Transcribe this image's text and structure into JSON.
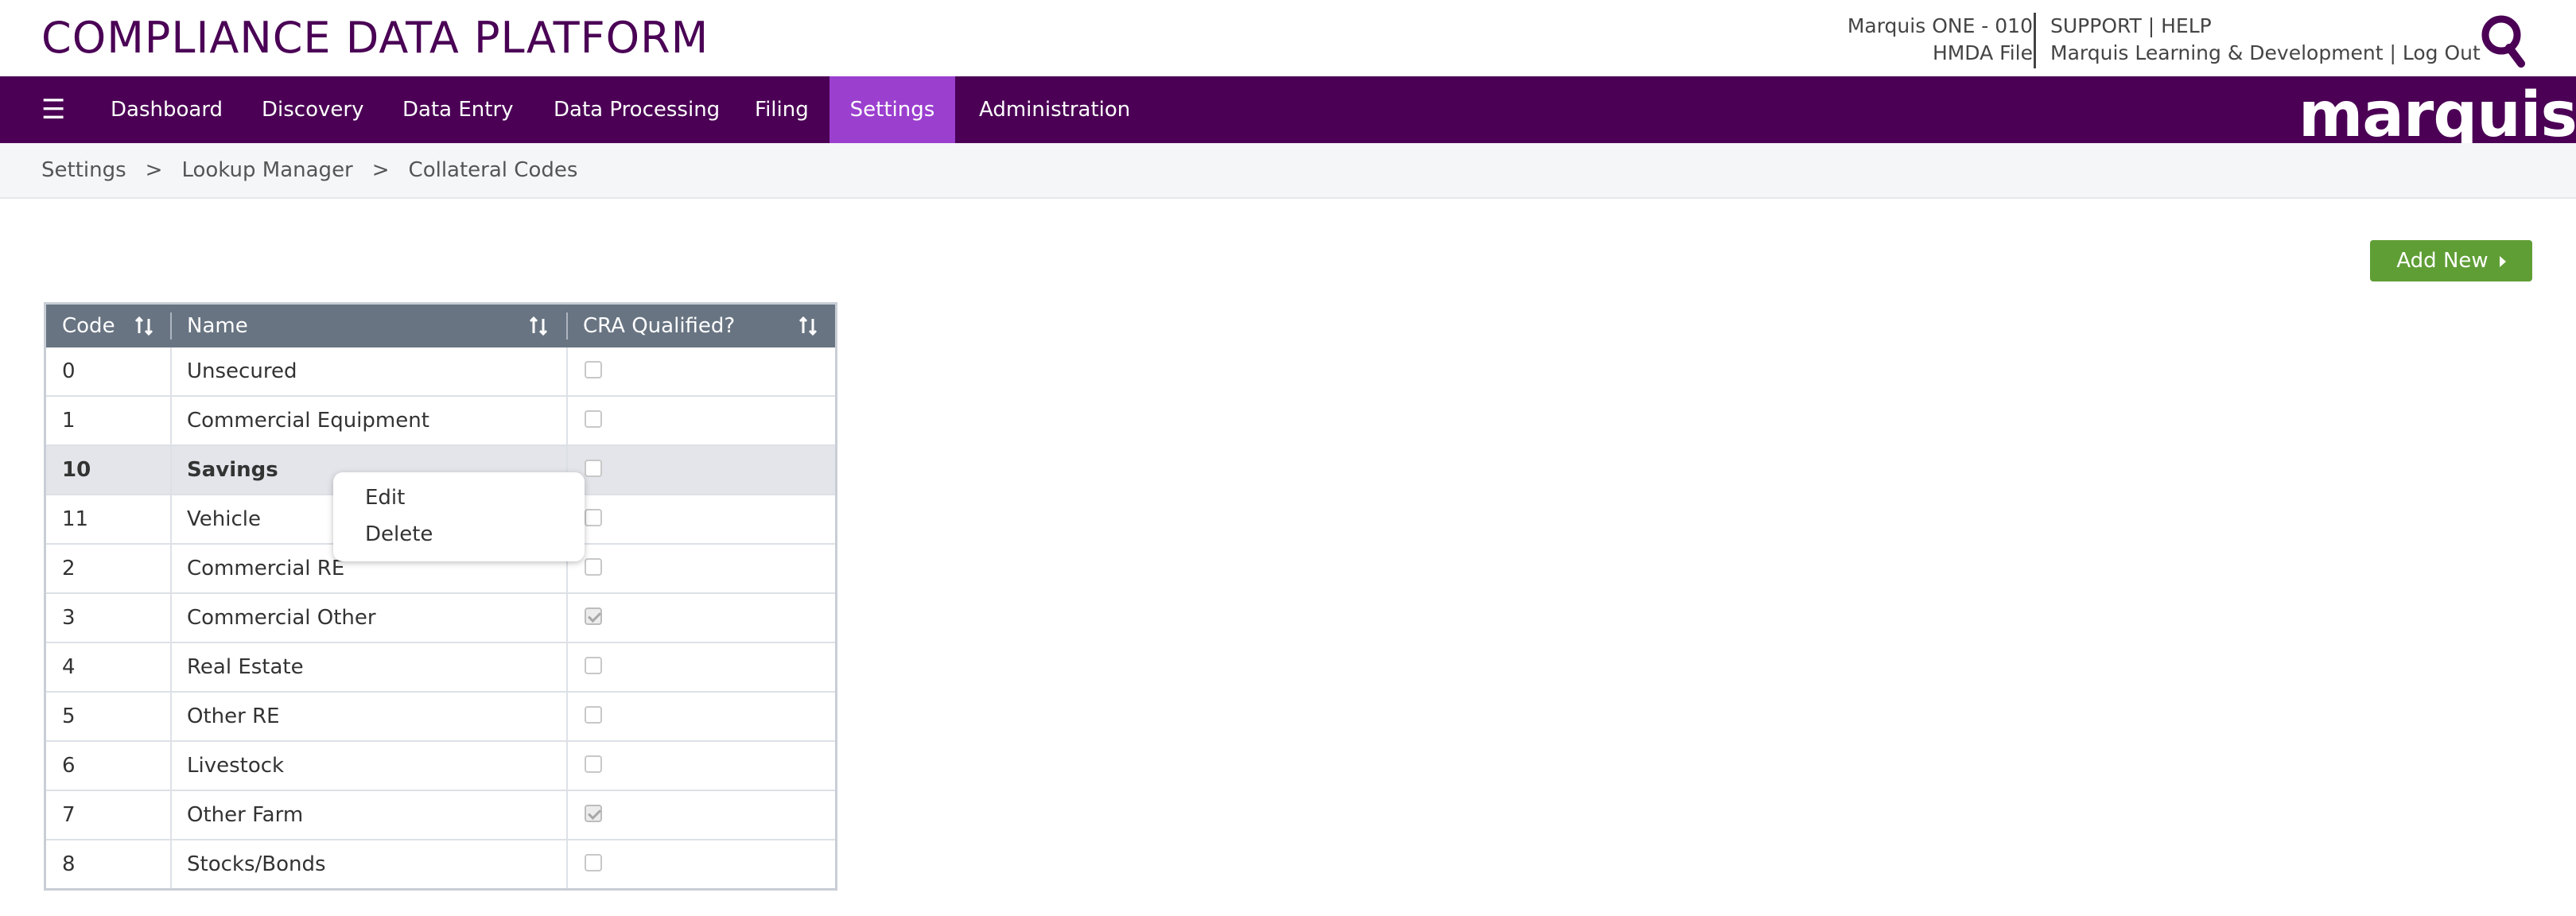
{
  "header": {
    "app_title": "COMPLIANCE DATA PLATFORM",
    "account_line1": "Marquis ONE - 010",
    "account_line2": "HMDA File",
    "links_line1": "SUPPORT | HELP",
    "links_line2": "Marquis Learning & Development | Log Out"
  },
  "nav": {
    "menu_icon": "hamburger-icon",
    "items": [
      {
        "label": "Dashboard"
      },
      {
        "label": "Discovery"
      },
      {
        "label": "Data Entry"
      },
      {
        "label": "Data Processing"
      },
      {
        "label": "Filing"
      },
      {
        "label": "Settings",
        "active": true
      },
      {
        "label": "Administration"
      }
    ],
    "brand": "marquis",
    "colors": {
      "nav_bg": "#4b0055",
      "active_bg": "#9b3fcf",
      "accent": "#5f9e35"
    }
  },
  "breadcrumb": {
    "items": [
      "Settings",
      "Lookup Manager",
      "Collateral Codes"
    ],
    "separator": ">"
  },
  "toolbar": {
    "add_new_label": "Add New"
  },
  "table": {
    "columns": [
      "Code",
      "Name",
      "CRA Qualified?"
    ],
    "rows": [
      {
        "code": "0",
        "name": "Unsecured",
        "cra": false
      },
      {
        "code": "1",
        "name": "Commercial Equipment",
        "cra": false
      },
      {
        "code": "10",
        "name": "Savings",
        "cra": false,
        "selected": true
      },
      {
        "code": "11",
        "name": "Vehicle",
        "cra": false
      },
      {
        "code": "2",
        "name": "Commercial RE",
        "cra": false
      },
      {
        "code": "3",
        "name": "Commercial Other",
        "cra": true
      },
      {
        "code": "4",
        "name": "Real Estate",
        "cra": false
      },
      {
        "code": "5",
        "name": "Other RE",
        "cra": false
      },
      {
        "code": "6",
        "name": "Livestock",
        "cra": false
      },
      {
        "code": "7",
        "name": "Other Farm",
        "cra": true
      },
      {
        "code": "8",
        "name": "Stocks/Bonds",
        "cra": false
      }
    ]
  },
  "context_menu": {
    "edit_label": "Edit",
    "delete_label": "Delete"
  }
}
